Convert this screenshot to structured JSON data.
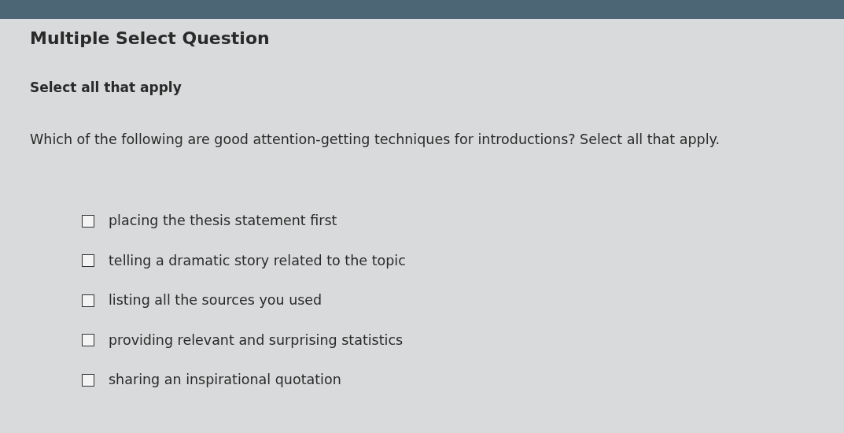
{
  "title": "Multiple Select Question",
  "instruction": "Select all that apply",
  "question": "Which of the following are good attention-getting techniques for introductions? Select all that apply.",
  "options": [
    {
      "label": "placing the thesis statement first",
      "checked": false
    },
    {
      "label": "telling a dramatic story related to the topic",
      "checked": false
    },
    {
      "label": "listing all the sources you used",
      "checked": false
    },
    {
      "label": "providing relevant and surprising statistics",
      "checked": false
    },
    {
      "label": "sharing an inspirational quotation",
      "checked": false
    }
  ]
}
